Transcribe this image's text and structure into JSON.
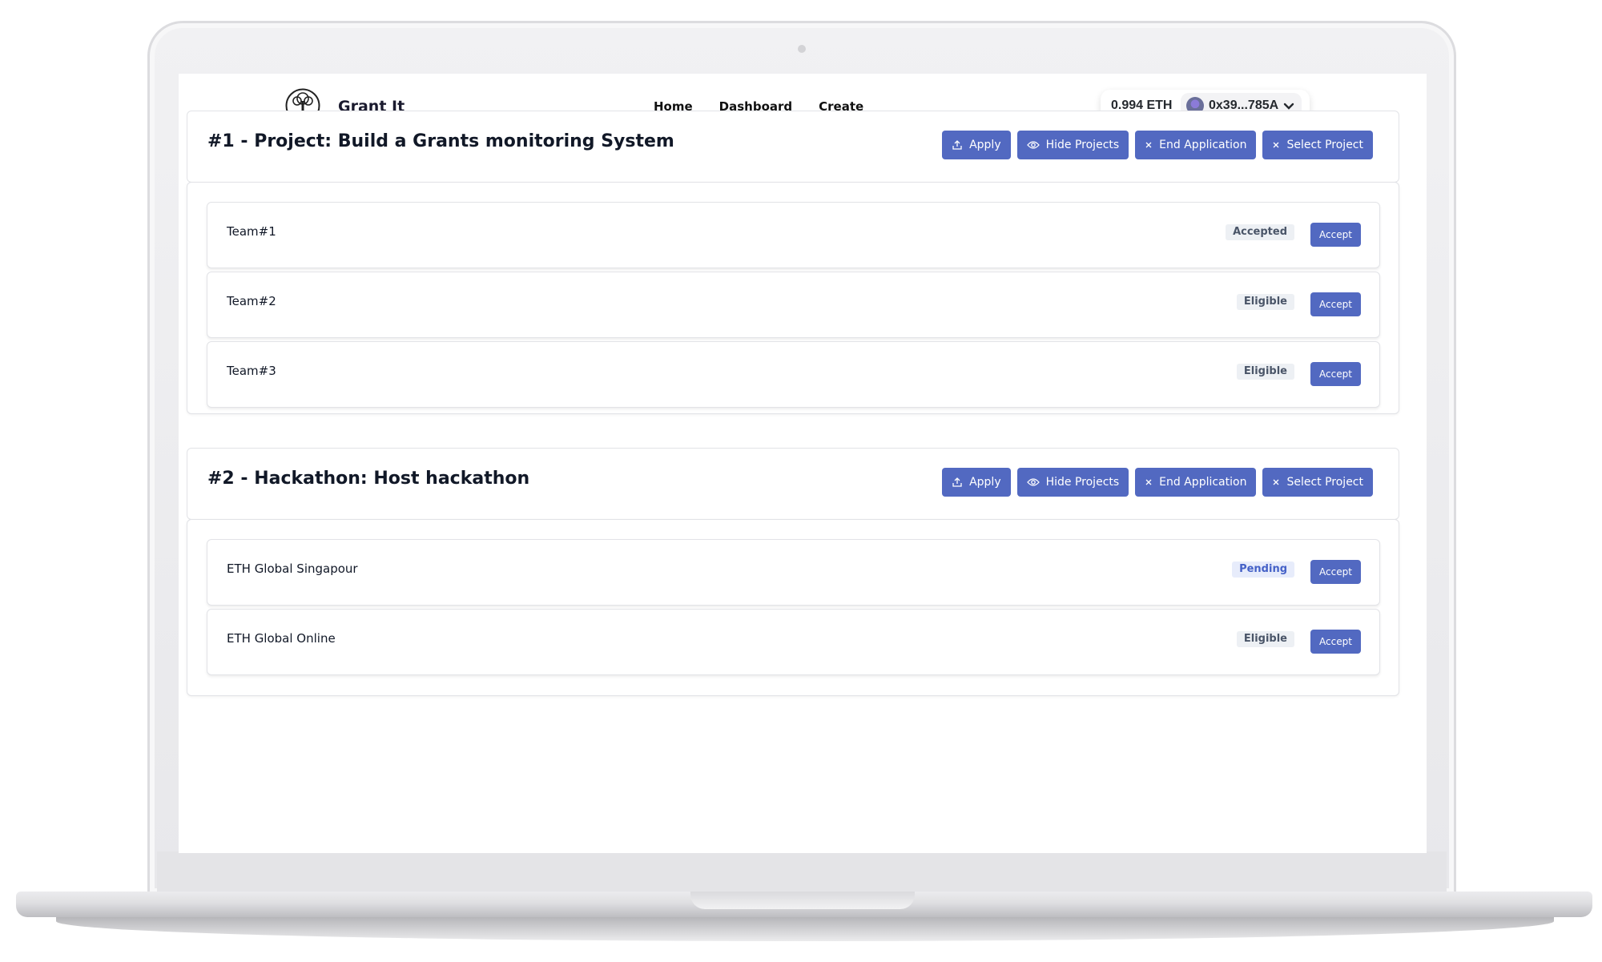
{
  "app": {
    "title": "Grant It"
  },
  "nav": [
    {
      "label": "Home"
    },
    {
      "label": "Dashboard"
    },
    {
      "label": "Create"
    }
  ],
  "wallet": {
    "balance": "0.994 ETH",
    "address": "0x39...785A"
  },
  "buttons": {
    "apply": "Apply",
    "hide_projects": "Hide Projects",
    "end_application": "End Application",
    "select_project": "Select Project",
    "accept": "Accept"
  },
  "projects": [
    {
      "title": "#1 - Project: Build a Grants monitoring System",
      "teams": [
        {
          "name": "Team#1",
          "status": "Accepted"
        },
        {
          "name": "Team#2",
          "status": "Eligible"
        },
        {
          "name": "Team#3",
          "status": "Eligible"
        }
      ]
    },
    {
      "title": "#2 - Hackathon: Host hackathon",
      "teams": [
        {
          "name": "ETH Global Singapour",
          "status": "Pending"
        },
        {
          "name": "ETH Global Online",
          "status": "Eligible"
        }
      ]
    }
  ],
  "colors": {
    "accent": "#5269c1",
    "pending_badge_text": "#4461c7",
    "badge_bg": "#edf0f4"
  },
  "icons": {
    "apply": "upload-icon",
    "hide_projects": "eye-icon",
    "end_application": "close-icon",
    "select_project": "close-icon",
    "wallet_menu": "chevron-down-icon",
    "logo": "tree-logo-icon"
  }
}
